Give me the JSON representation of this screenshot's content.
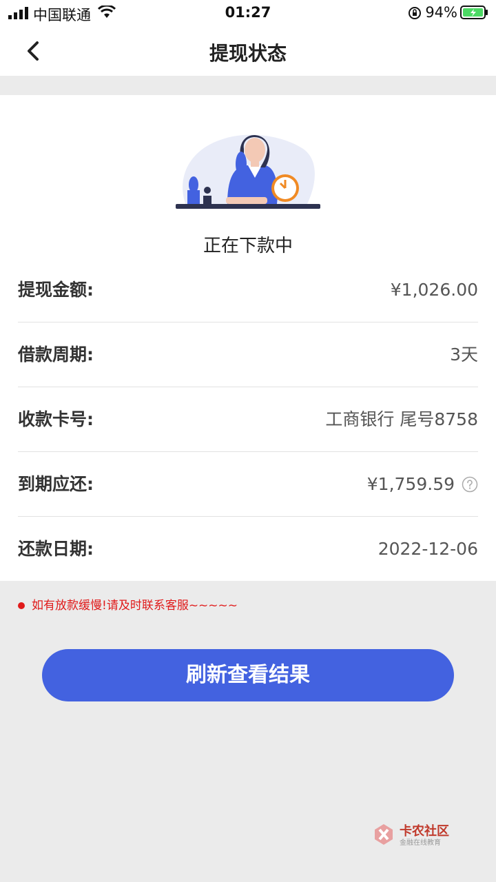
{
  "status_bar": {
    "carrier": "中国联通",
    "time": "01:27",
    "battery": "94%"
  },
  "nav": {
    "title": "提现状态"
  },
  "status": {
    "text": "正在下款中"
  },
  "details": [
    {
      "label": "提现金额:",
      "value": "¥1,026.00"
    },
    {
      "label": "借款周期:",
      "value": "3天"
    },
    {
      "label": "收款卡号:",
      "value": "工商银行 尾号8758"
    },
    {
      "label": "到期应还:",
      "value": "¥1,759.59"
    },
    {
      "label": "还款日期:",
      "value": "2022-12-06"
    }
  ],
  "notice": "如有放款缓慢!请及时联系客服~~~~~",
  "refresh_button": "刷新查看结果",
  "watermark": {
    "title": "卡农社区",
    "subtitle": "金融在线教育"
  },
  "colors": {
    "accent": "#4362e0",
    "warning": "#e01a1a",
    "clock": "#f08a24"
  }
}
